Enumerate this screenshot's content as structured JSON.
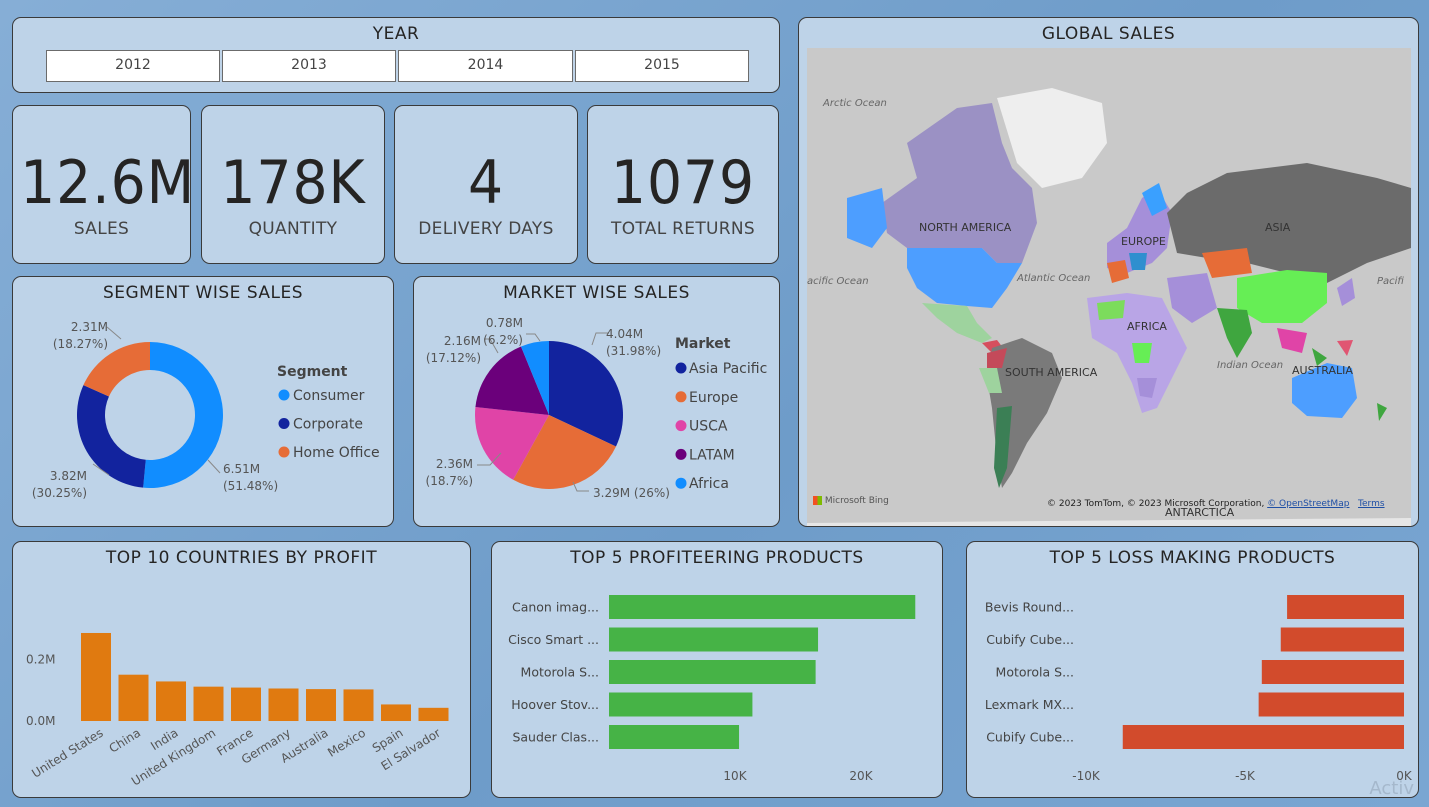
{
  "year_slicer": {
    "title": "YEAR",
    "options": [
      "2012",
      "2013",
      "2014",
      "2015"
    ]
  },
  "kpis": [
    {
      "value": "12.6M",
      "label": "SALES"
    },
    {
      "value": "178K",
      "label": "QUANTITY"
    },
    {
      "value": "4",
      "label": "DELIVERY DAYS"
    },
    {
      "value": "1079",
      "label": "TOTAL RETURNS"
    }
  ],
  "segment_chart": {
    "title": "SEGMENT WISE SALES",
    "legend_title": "Segment",
    "slices": [
      {
        "name": "Consumer",
        "value": 6.51,
        "pct": 51.48,
        "label_value": "6.51M",
        "label_pct": "(51.48%)",
        "color": "#118dff"
      },
      {
        "name": "Corporate",
        "value": 3.82,
        "pct": 30.25,
        "label_value": "3.82M",
        "label_pct": "(30.25%)",
        "color": "#12239e"
      },
      {
        "name": "Home Office",
        "value": 2.31,
        "pct": 18.27,
        "label_value": "2.31M",
        "label_pct": "(18.27%)",
        "color": "#e66c37"
      }
    ]
  },
  "market_chart": {
    "title": "MARKET WISE SALES",
    "legend_title": "Market",
    "slices": [
      {
        "name": "Asia Pacific",
        "value": 4.04,
        "pct": 31.98,
        "label_value": "4.04M",
        "label_pct": "(31.98%)",
        "color": "#12239e"
      },
      {
        "name": "Europe",
        "value": 3.29,
        "pct": 26,
        "label_value": "3.29M (26%)",
        "label_pct": "",
        "color": "#e66c37"
      },
      {
        "name": "USCA",
        "value": 2.36,
        "pct": 18.7,
        "label_value": "2.36M",
        "label_pct": "(18.7%)",
        "color": "#e044a7"
      },
      {
        "name": "LATAM",
        "value": 2.16,
        "pct": 17.12,
        "label_value": "2.16M",
        "label_pct": "(17.12%)",
        "color": "#6b007b"
      },
      {
        "name": "Africa",
        "value": 0.78,
        "pct": 6.2,
        "label_value": "0.78M",
        "label_pct": "(6.2%)",
        "color": "#118dff"
      }
    ]
  },
  "global_sales": {
    "title": "GLOBAL SALES",
    "labels": {
      "north_america": "NORTH AMERICA",
      "south_america": "SOUTH AMERICA",
      "europe": "EUROPE",
      "africa": "AFRICA",
      "asia": "ASIA",
      "australia": "AUSTRALIA",
      "antarctica": "ANTARCTICA",
      "arctic": "Arctic Ocean",
      "atlantic": "Atlantic Ocean",
      "pacific_left": "acific Ocean",
      "pacific_right": "Pacifi",
      "indian": "Indian Ocean"
    },
    "bing_logo": "Microsoft Bing",
    "attribution": "© 2023 TomTom, © 2023 Microsoft Corporation,",
    "osm_link": "© OpenStreetMap",
    "terms_link": "Terms"
  },
  "chart_data": [
    {
      "type": "bar",
      "title": "TOP 10 COUNTRIES BY PROFIT",
      "categories": [
        "United States",
        "China",
        "India",
        "United Kingdom",
        "France",
        "Germany",
        "Australia",
        "Mexico",
        "Spain",
        "El Salvador"
      ],
      "values": [
        0.287,
        0.151,
        0.129,
        0.112,
        0.109,
        0.106,
        0.104,
        0.103,
        0.054,
        0.043
      ],
      "yticks": [
        "0.0M",
        "0.2M"
      ],
      "ylim": [
        0,
        0.3
      ],
      "color": "#e07a10"
    },
    {
      "type": "bar",
      "orientation": "horizontal",
      "title": "TOP 5 PROFITEERING PRODUCTS",
      "categories": [
        "Canon imag...",
        "Cisco Smart ...",
        "Motorola S...",
        "Hoover Stov...",
        "Sauder Clas..."
      ],
      "values": [
        25200,
        17200,
        17000,
        11800,
        10700
      ],
      "xticks": [
        "10K",
        "20K"
      ],
      "xlim": [
        0,
        26000
      ],
      "color": "#46b346"
    },
    {
      "type": "bar",
      "orientation": "horizontal",
      "title": "TOP 5 LOSS MAKING PRODUCTS",
      "categories": [
        "Bevis Round...",
        "Cubify Cube...",
        "Motorola S...",
        "Lexmark MX...",
        "Cubify Cube..."
      ],
      "values": [
        -3700,
        -3900,
        -4500,
        -4600,
        -8900
      ],
      "xticks": [
        "-10K",
        "-5K",
        "0K"
      ],
      "xlim": [
        -10000,
        0
      ],
      "color": "#d24b2c"
    }
  ],
  "watermark": "Activ"
}
